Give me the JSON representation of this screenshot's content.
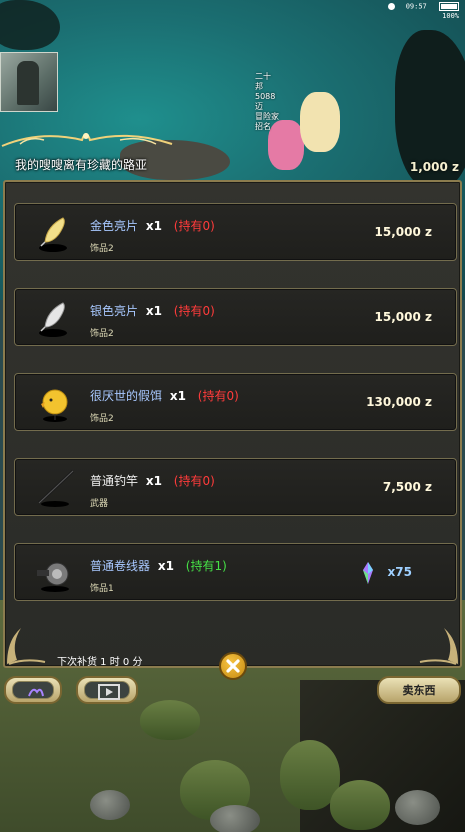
{
  "status_bar": {
    "time": "09:57",
    "battery": "100%"
  },
  "shop": {
    "title": "我的嗖嗖离有珍藏的路亚",
    "currency": "1,000 z",
    "restock_text": "下次补货 1 时 0 分",
    "sell_button": "卖东西"
  },
  "npc_names": [
    "二十",
    "邦",
    "5088",
    "迈",
    "冒险家",
    "招名"
  ],
  "items": [
    {
      "name": "金色亮片",
      "qty": "x1",
      "owned": "(持有0)",
      "category": "饰品2",
      "price": "15,000 z",
      "name_color": "blue",
      "owned_color": "red",
      "icon": "gold-spoon-lure-icon"
    },
    {
      "name": "银色亮片",
      "qty": "x1",
      "owned": "(持有0)",
      "category": "饰品2",
      "price": "15,000 z",
      "name_color": "blue",
      "owned_color": "red",
      "icon": "silver-spoon-lure-icon"
    },
    {
      "name": "很厌世的假饵",
      "qty": "x1",
      "owned": "(持有0)",
      "category": "饰品2",
      "price": "130,000 z",
      "name_color": "blue",
      "owned_color": "red",
      "icon": "yellow-chick-lure-icon"
    },
    {
      "name": "普通钓竿",
      "qty": "x1",
      "owned": "(持有0)",
      "category": "武器",
      "price": "7,500 z",
      "name_color": "white",
      "owned_color": "red",
      "icon": "fishing-rod-icon"
    },
    {
      "name": "普通卷线器",
      "qty": "x1",
      "owned": "(持有1)",
      "category": "饰品1",
      "price": "x75",
      "name_color": "blue",
      "owned_color": "green",
      "icon": "fishing-reel-icon"
    }
  ],
  "colors": {
    "panel_border": "#8b7c4e",
    "owned_red": "#ff3b3b",
    "owned_green": "#46e046",
    "name_blue": "#a8c8ff",
    "gold": "#f6c341"
  }
}
